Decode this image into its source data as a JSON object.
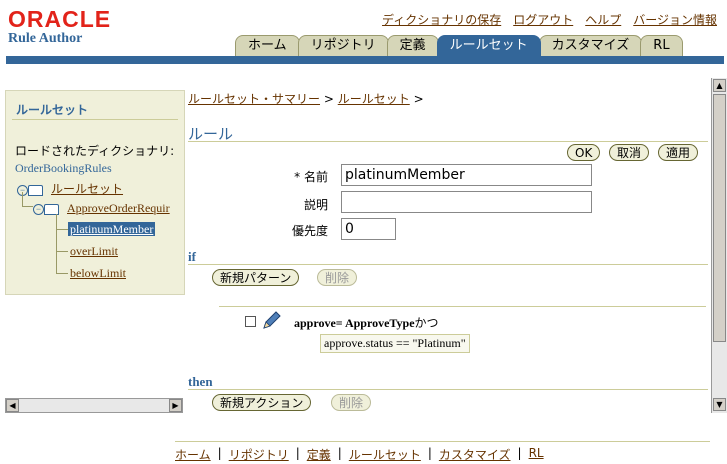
{
  "header": {
    "logo": "ORACLE",
    "app_name": "Rule Author",
    "global_links": [
      "ディクショナリの保存",
      "ログアウト",
      "ヘルプ",
      "バージョン情報"
    ]
  },
  "tabs": [
    {
      "label": "ホーム",
      "active": false
    },
    {
      "label": "リポジトリ",
      "active": false
    },
    {
      "label": "定義",
      "active": false
    },
    {
      "label": "ルールセット",
      "active": true
    },
    {
      "label": "カスタマイズ",
      "active": false
    },
    {
      "label": "RL",
      "active": false
    }
  ],
  "left": {
    "title": "ルールセット",
    "loaded_label": "ロードされたディクショナリ:",
    "dictionary": "OrderBookingRules",
    "tree": {
      "root": "ルールセット",
      "ruleset": "ApproveOrderRequir",
      "rules": [
        "platinumMember",
        "overLimit",
        "belowLimit"
      ],
      "selected_index": 0
    }
  },
  "main": {
    "breadcrumb": [
      "ルールセット・サマリー",
      "ルールセット"
    ],
    "breadcrumb_sep": ">",
    "title": "ルール",
    "buttons": {
      "ok": "OK",
      "cancel": "取消",
      "apply": "適用"
    },
    "fields": {
      "name_label": "* 名前",
      "name_value": "platinumMember",
      "desc_label": "説明",
      "desc_value": "",
      "priority_label": "優先度",
      "priority_value": "0"
    },
    "if": {
      "label": "if",
      "new_button": "新規パターン",
      "delete_button": "削除",
      "pattern_bold": "approve= ApproveType",
      "pattern_suffix": "かつ",
      "condition_left": "approve.status",
      "condition_op": "==",
      "condition_right": "\"Platinum\""
    },
    "then": {
      "label": "then",
      "new_button": "新規アクション",
      "delete_button": "削除"
    }
  },
  "footer": {
    "links": [
      "ホーム",
      "リポジトリ",
      "定義",
      "ルールセット",
      "カスタマイズ",
      "RL"
    ],
    "sep": "|"
  }
}
